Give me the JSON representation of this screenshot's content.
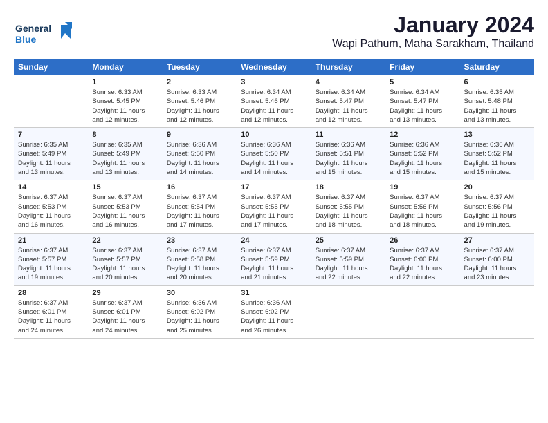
{
  "logo": {
    "general": "General",
    "blue": "Blue",
    "tagline": ""
  },
  "header": {
    "month": "January 2024",
    "location": "Wapi Pathum, Maha Sarakham, Thailand"
  },
  "columns": [
    "Sunday",
    "Monday",
    "Tuesday",
    "Wednesday",
    "Thursday",
    "Friday",
    "Saturday"
  ],
  "weeks": [
    [
      {
        "day": "",
        "info": ""
      },
      {
        "day": "1",
        "info": "Sunrise: 6:33 AM\nSunset: 5:45 PM\nDaylight: 11 hours\nand 12 minutes."
      },
      {
        "day": "2",
        "info": "Sunrise: 6:33 AM\nSunset: 5:46 PM\nDaylight: 11 hours\nand 12 minutes."
      },
      {
        "day": "3",
        "info": "Sunrise: 6:34 AM\nSunset: 5:46 PM\nDaylight: 11 hours\nand 12 minutes."
      },
      {
        "day": "4",
        "info": "Sunrise: 6:34 AM\nSunset: 5:47 PM\nDaylight: 11 hours\nand 12 minutes."
      },
      {
        "day": "5",
        "info": "Sunrise: 6:34 AM\nSunset: 5:47 PM\nDaylight: 11 hours\nand 13 minutes."
      },
      {
        "day": "6",
        "info": "Sunrise: 6:35 AM\nSunset: 5:48 PM\nDaylight: 11 hours\nand 13 minutes."
      }
    ],
    [
      {
        "day": "7",
        "info": "Sunrise: 6:35 AM\nSunset: 5:49 PM\nDaylight: 11 hours\nand 13 minutes."
      },
      {
        "day": "8",
        "info": "Sunrise: 6:35 AM\nSunset: 5:49 PM\nDaylight: 11 hours\nand 13 minutes."
      },
      {
        "day": "9",
        "info": "Sunrise: 6:36 AM\nSunset: 5:50 PM\nDaylight: 11 hours\nand 14 minutes."
      },
      {
        "day": "10",
        "info": "Sunrise: 6:36 AM\nSunset: 5:50 PM\nDaylight: 11 hours\nand 14 minutes."
      },
      {
        "day": "11",
        "info": "Sunrise: 6:36 AM\nSunset: 5:51 PM\nDaylight: 11 hours\nand 15 minutes."
      },
      {
        "day": "12",
        "info": "Sunrise: 6:36 AM\nSunset: 5:52 PM\nDaylight: 11 hours\nand 15 minutes."
      },
      {
        "day": "13",
        "info": "Sunrise: 6:36 AM\nSunset: 5:52 PM\nDaylight: 11 hours\nand 15 minutes."
      }
    ],
    [
      {
        "day": "14",
        "info": "Sunrise: 6:37 AM\nSunset: 5:53 PM\nDaylight: 11 hours\nand 16 minutes."
      },
      {
        "day": "15",
        "info": "Sunrise: 6:37 AM\nSunset: 5:53 PM\nDaylight: 11 hours\nand 16 minutes."
      },
      {
        "day": "16",
        "info": "Sunrise: 6:37 AM\nSunset: 5:54 PM\nDaylight: 11 hours\nand 17 minutes."
      },
      {
        "day": "17",
        "info": "Sunrise: 6:37 AM\nSunset: 5:55 PM\nDaylight: 11 hours\nand 17 minutes."
      },
      {
        "day": "18",
        "info": "Sunrise: 6:37 AM\nSunset: 5:55 PM\nDaylight: 11 hours\nand 18 minutes."
      },
      {
        "day": "19",
        "info": "Sunrise: 6:37 AM\nSunset: 5:56 PM\nDaylight: 11 hours\nand 18 minutes."
      },
      {
        "day": "20",
        "info": "Sunrise: 6:37 AM\nSunset: 5:56 PM\nDaylight: 11 hours\nand 19 minutes."
      }
    ],
    [
      {
        "day": "21",
        "info": "Sunrise: 6:37 AM\nSunset: 5:57 PM\nDaylight: 11 hours\nand 19 minutes."
      },
      {
        "day": "22",
        "info": "Sunrise: 6:37 AM\nSunset: 5:57 PM\nDaylight: 11 hours\nand 20 minutes."
      },
      {
        "day": "23",
        "info": "Sunrise: 6:37 AM\nSunset: 5:58 PM\nDaylight: 11 hours\nand 20 minutes."
      },
      {
        "day": "24",
        "info": "Sunrise: 6:37 AM\nSunset: 5:59 PM\nDaylight: 11 hours\nand 21 minutes."
      },
      {
        "day": "25",
        "info": "Sunrise: 6:37 AM\nSunset: 5:59 PM\nDaylight: 11 hours\nand 22 minutes."
      },
      {
        "day": "26",
        "info": "Sunrise: 6:37 AM\nSunset: 6:00 PM\nDaylight: 11 hours\nand 22 minutes."
      },
      {
        "day": "27",
        "info": "Sunrise: 6:37 AM\nSunset: 6:00 PM\nDaylight: 11 hours\nand 23 minutes."
      }
    ],
    [
      {
        "day": "28",
        "info": "Sunrise: 6:37 AM\nSunset: 6:01 PM\nDaylight: 11 hours\nand 24 minutes."
      },
      {
        "day": "29",
        "info": "Sunrise: 6:37 AM\nSunset: 6:01 PM\nDaylight: 11 hours\nand 24 minutes."
      },
      {
        "day": "30",
        "info": "Sunrise: 6:36 AM\nSunset: 6:02 PM\nDaylight: 11 hours\nand 25 minutes."
      },
      {
        "day": "31",
        "info": "Sunrise: 6:36 AM\nSunset: 6:02 PM\nDaylight: 11 hours\nand 26 minutes."
      },
      {
        "day": "",
        "info": ""
      },
      {
        "day": "",
        "info": ""
      },
      {
        "day": "",
        "info": ""
      }
    ]
  ]
}
